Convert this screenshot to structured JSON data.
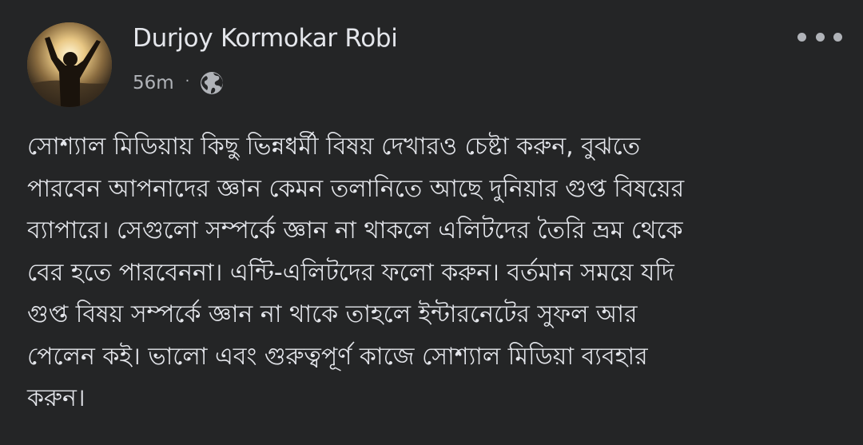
{
  "post": {
    "author": {
      "name": "Durjoy Kormokar Robi",
      "avatar": "avatar-photo"
    },
    "timestamp": "56m",
    "separator": "·",
    "privacy_icon": "globe-icon",
    "more_icon": "more-options-icon",
    "text_lines": [
      "সোশ্যাল মিডিয়ায় কিছু ভিন্নধর্মী বিষয় দেখারও চেষ্টা করুন, বুঝতে",
      "পারবেন আপনাদের জ্ঞান কেমন তলানিতে আছে দুনিয়ার গুপ্ত বিষয়ের",
      "ব্যাপারে। সেগুলো সম্পর্কে জ্ঞান না থাকলে এলিটদের তৈরি ভ্রম থেকে",
      "বের হতে পারবেননা। এন্টি-এলিটদের ফলো করুন। বর্তমান সময়ে যদি",
      "গুপ্ত বিষয় সম্পর্কে জ্ঞান না থাকে তাহলে ইন্টারনেটের সুফল আর",
      "পেলেন কই। ভালো এবং গুরুত্বপূর্ণ কাজে সোশ্যাল মিডিয়া ব্যবহার",
      "করুন।"
    ]
  },
  "colors": {
    "background": "#242526",
    "primary_text": "#e4e6eb",
    "secondary_text": "#b0b3b8"
  }
}
